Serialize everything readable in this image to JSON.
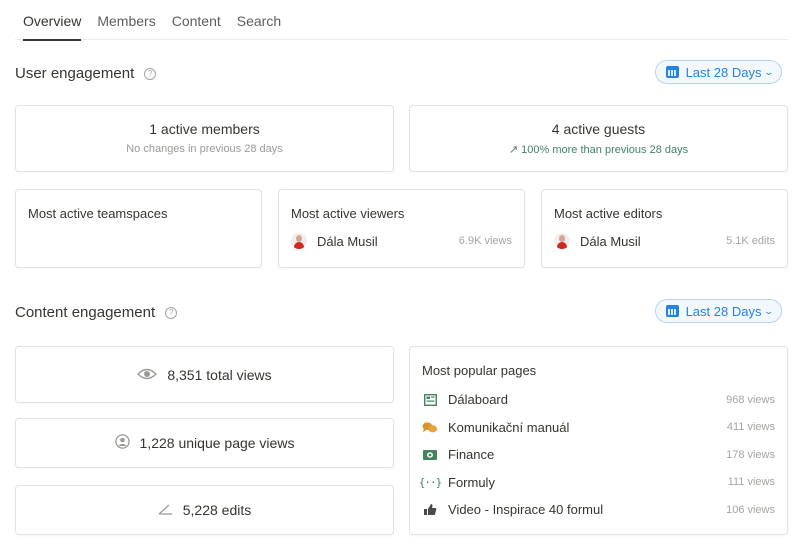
{
  "tabs": [
    {
      "label": "Overview",
      "active": true
    },
    {
      "label": "Members",
      "active": false
    },
    {
      "label": "Content",
      "active": false
    },
    {
      "label": "Search",
      "active": false
    }
  ],
  "user_engagement": {
    "title": "User engagement",
    "help_icon": "question-circle-icon",
    "date_range": "Last 28 Days",
    "active_members": {
      "label": "1 active members",
      "sub": "No changes in previous 28 days"
    },
    "active_guests": {
      "label": "4 active guests",
      "trend_icon": "arrow-up-right",
      "sub": "100% more than previous 28 days"
    },
    "teamspaces": {
      "title": "Most active teamspaces"
    },
    "viewers": {
      "title": "Most active viewers",
      "name": "Dála Musil",
      "value": "6.9K views"
    },
    "editors": {
      "title": "Most active editors",
      "name": "Dála Musil",
      "value": "5.1K edits"
    }
  },
  "content_engagement": {
    "title": "Content engagement",
    "date_range": "Last 28 Days",
    "total_views": "8,351 total views",
    "unique_views": "1,228 unique page views",
    "edits": "5,228 edits",
    "popular": {
      "title": "Most popular pages",
      "pages": [
        {
          "name": "Dálaboard",
          "views": "968 views",
          "icon": "dashboard-icon",
          "color": "#448361"
        },
        {
          "name": "Komunikační manuál",
          "views": "411 views",
          "icon": "chat-bubbles-icon",
          "color": "#d9922e"
        },
        {
          "name": "Finance",
          "views": "178 views",
          "icon": "money-icon",
          "color": "#448361"
        },
        {
          "name": "Formuly",
          "views": "111 views",
          "icon": "braces-icon",
          "color": "#448361"
        },
        {
          "name": "Video - Inspirace 40 formul",
          "views": "106 views",
          "icon": "thumbs-up-icon",
          "color": "#4a4a48"
        }
      ]
    }
  },
  "colors": {
    "accent": "#2383e2",
    "positive": "#448361",
    "muted": "#9b9a97"
  }
}
